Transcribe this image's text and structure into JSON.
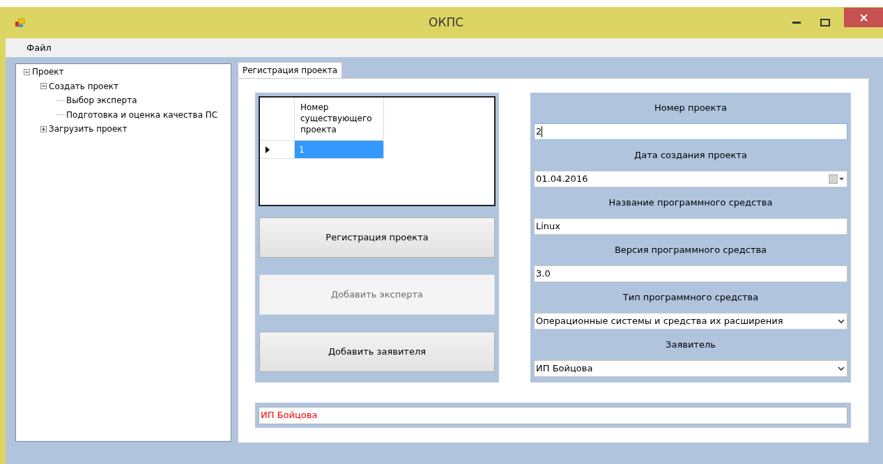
{
  "window": {
    "title": "ОКПС"
  },
  "menu": [
    "Файл"
  ],
  "tree": [
    {
      "label": "Проект",
      "expanded": true,
      "children": [
        {
          "label": "Создать проект",
          "expanded": true,
          "children": [
            {
              "label": "Выбор эксперта"
            },
            {
              "label": "Подготовка и оценка качества ПС"
            }
          ]
        },
        {
          "label": "Загрузить проект",
          "expanded": false
        }
      ]
    }
  ],
  "tabs": [
    {
      "label": "Регистрация проекта",
      "selected": true
    }
  ],
  "grid": {
    "columns": [
      "Номер существующего проекта"
    ],
    "rows": [
      {
        "cells": [
          "1"
        ],
        "selected": true
      }
    ]
  },
  "buttons": [
    {
      "label": "Регистрация проекта",
      "disabled": false
    },
    {
      "label": "Добавить эксперта",
      "disabled": true
    },
    {
      "label": "Добавить заявителя",
      "disabled": false
    }
  ],
  "fields": [
    {
      "label": "Номер проекта",
      "kind": "text",
      "value": "2"
    },
    {
      "label": "Дата создания проекта",
      "kind": "date",
      "value": "01.04.2016"
    },
    {
      "label": "Название программного средства",
      "kind": "text",
      "value": "Linux"
    },
    {
      "label": "Версия программного средства",
      "kind": "text",
      "value": "3.0"
    },
    {
      "label": "Тип программного средства",
      "kind": "select",
      "value": "Операционные системы и средства их расширения"
    },
    {
      "label": "Заявитель",
      "kind": "select",
      "value": "ИП Бойцова"
    }
  ],
  "status_text": {
    "value": "ИП Бойцова",
    "color": "#ff0000"
  }
}
